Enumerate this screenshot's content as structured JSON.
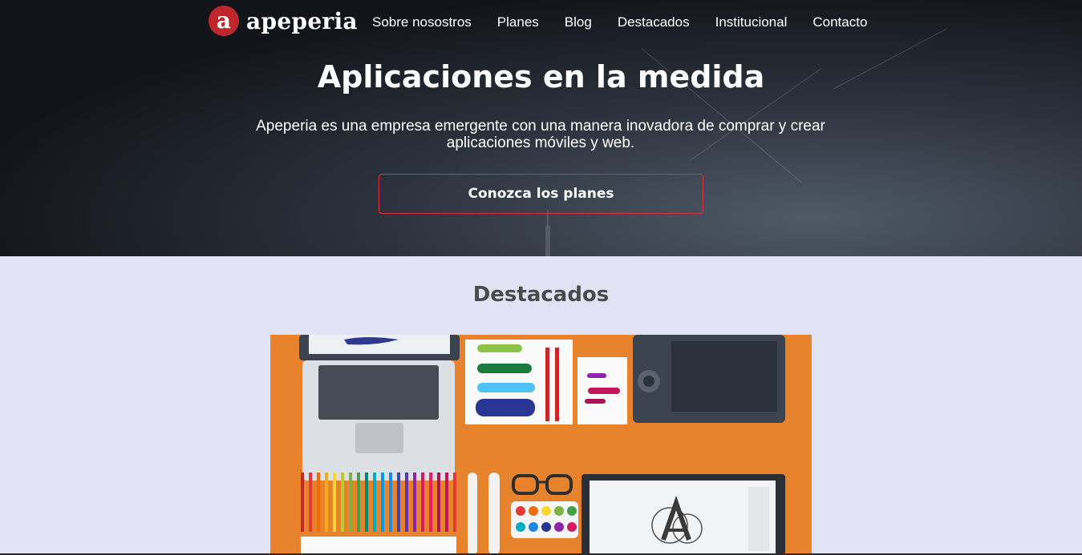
{
  "header": {
    "logo_letter": "a",
    "logo_text": "apeperia",
    "nav": [
      "Sobre nosostros",
      "Planes",
      "Blog",
      "Destacados",
      "Institucional",
      "Contacto"
    ]
  },
  "hero": {
    "title": "Aplicaciones en la medida",
    "subtitle": "Apeperia es una empresa emergente con una manera inovadora de comprar y crear aplicaciones móviles y web.",
    "cta": "Conozca los planes"
  },
  "featured": {
    "title": "Destacados"
  },
  "colors": {
    "brand_red": "#c0272d",
    "section_bg": "#e1e3f5",
    "image_orange": "#e8832d"
  }
}
